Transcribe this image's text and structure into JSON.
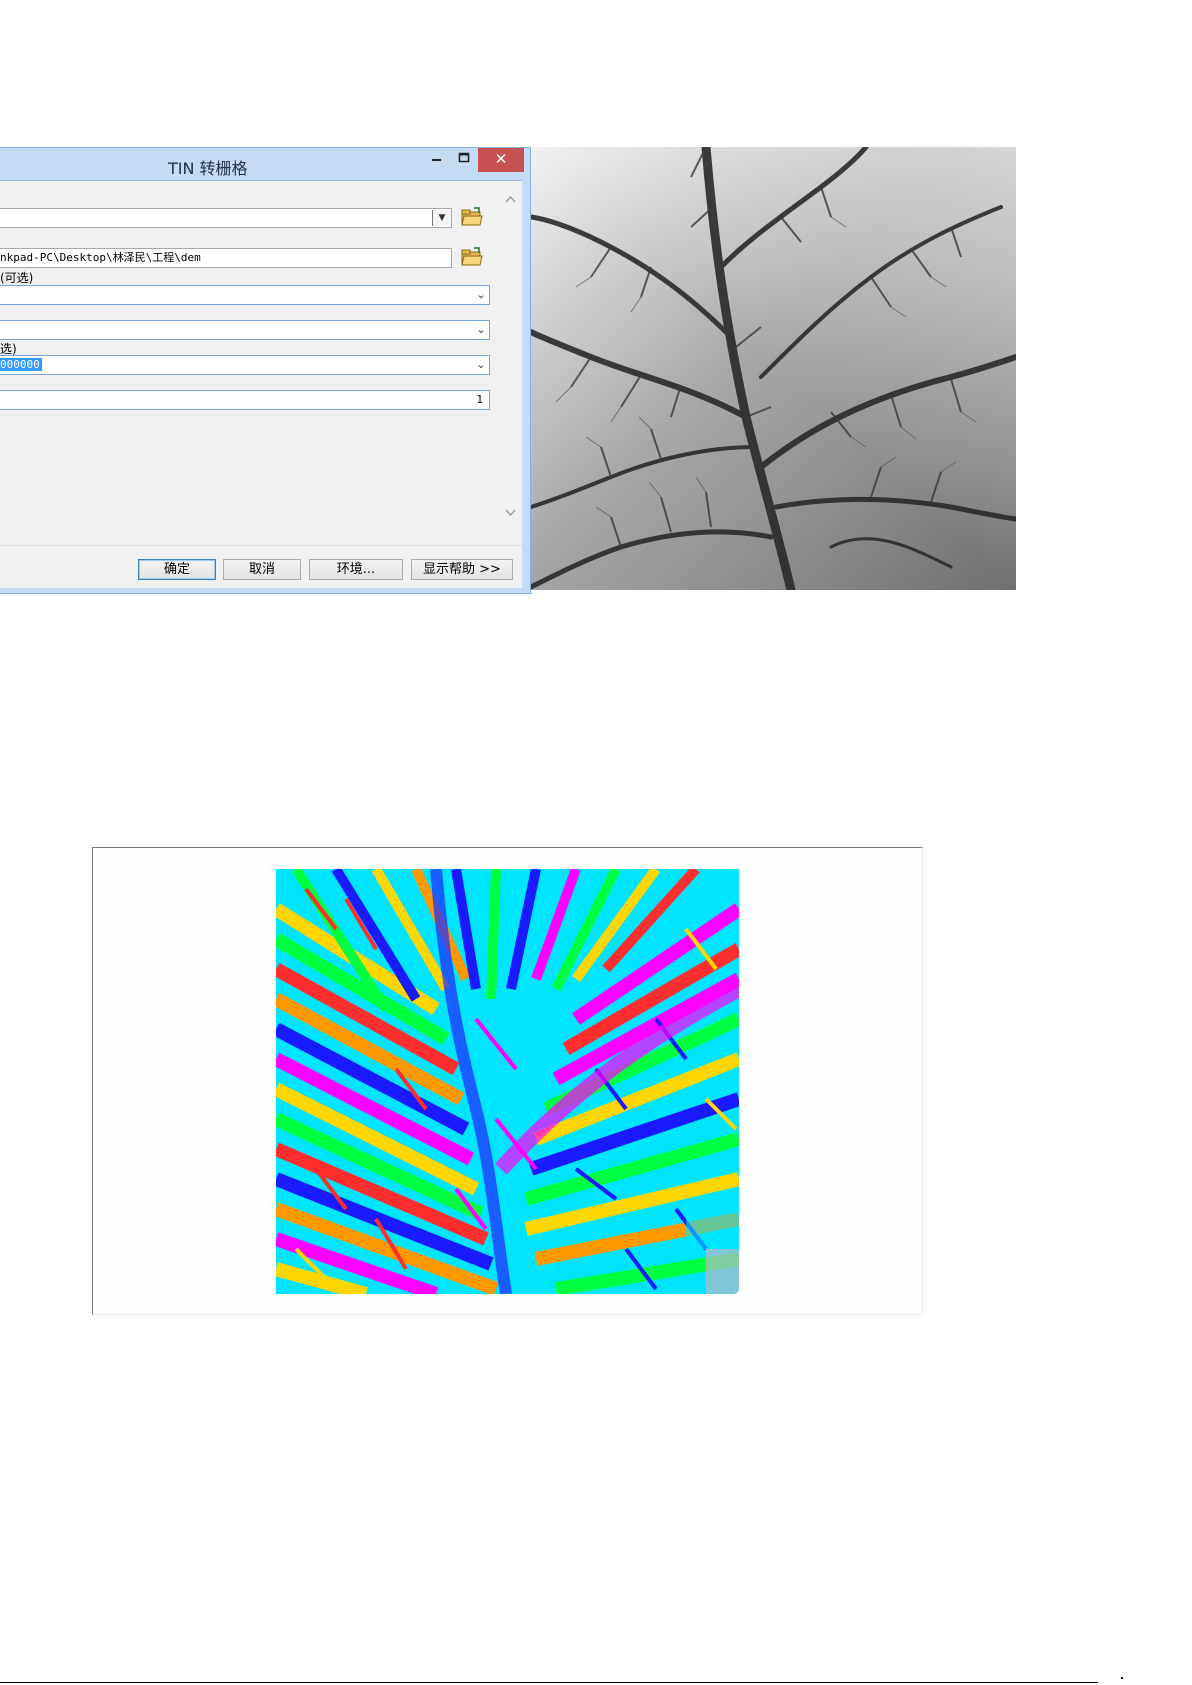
{
  "dialog": {
    "title": "TIN 转栅格",
    "title_icons": [
      "minimize-icon",
      "maximize-icon",
      "close-icon"
    ],
    "close_glyph": "✕",
    "fields": {
      "input_tin": "",
      "output_raster": "nkpad-PC\\Desktop\\林泽民\\工程\\dem",
      "output_label_fragment": "(可选)",
      "output_data_type": "",
      "method": "",
      "sampling_label_fragment": "选)",
      "sampling_distance_value": "000000",
      "sampling_distance_prefix": "",
      "z_factor": "1"
    },
    "buttons": {
      "ok": "确定",
      "cancel": "取消",
      "environments": "环境...",
      "show_help": "显示帮助 >>"
    },
    "colors": {
      "close": "#c75050",
      "selection": "#3399ff",
      "frame": "#c4dbf3"
    }
  },
  "images": {
    "dem": "grayscale-dem-raster",
    "aspect": "aspect-raster-colored"
  }
}
